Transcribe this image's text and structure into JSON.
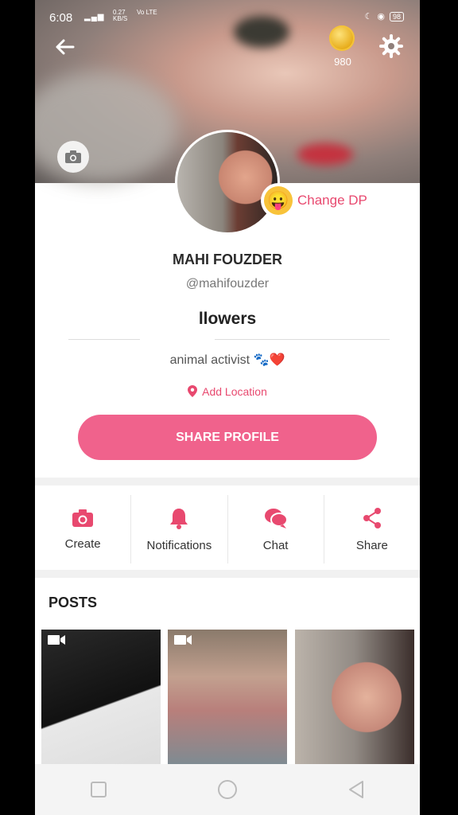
{
  "status": {
    "time": "6:08",
    "net_speed": "0.27",
    "net_unit": "KB/S",
    "volte": "Vo LTE",
    "battery": "98"
  },
  "header": {
    "coin_count": "980"
  },
  "profile": {
    "change_dp_label": "Change DP",
    "name": "MAHI FOUZDER",
    "handle": "@mahifouzder",
    "followers_label": "llowers",
    "bio": "animal activist 🐾❤️",
    "location_label": "Add Location"
  },
  "share_profile_label": "SHARE PROFILE",
  "actions": [
    {
      "label": "Create",
      "icon": "camera-icon"
    },
    {
      "label": "Notifications",
      "icon": "bell-icon"
    },
    {
      "label": "Chat",
      "icon": "chat-icon"
    },
    {
      "label": "Share",
      "icon": "share-icon"
    }
  ],
  "posts": {
    "title": "POSTS"
  },
  "colors": {
    "accent": "#f0628c",
    "accent_text": "#e8496f"
  }
}
